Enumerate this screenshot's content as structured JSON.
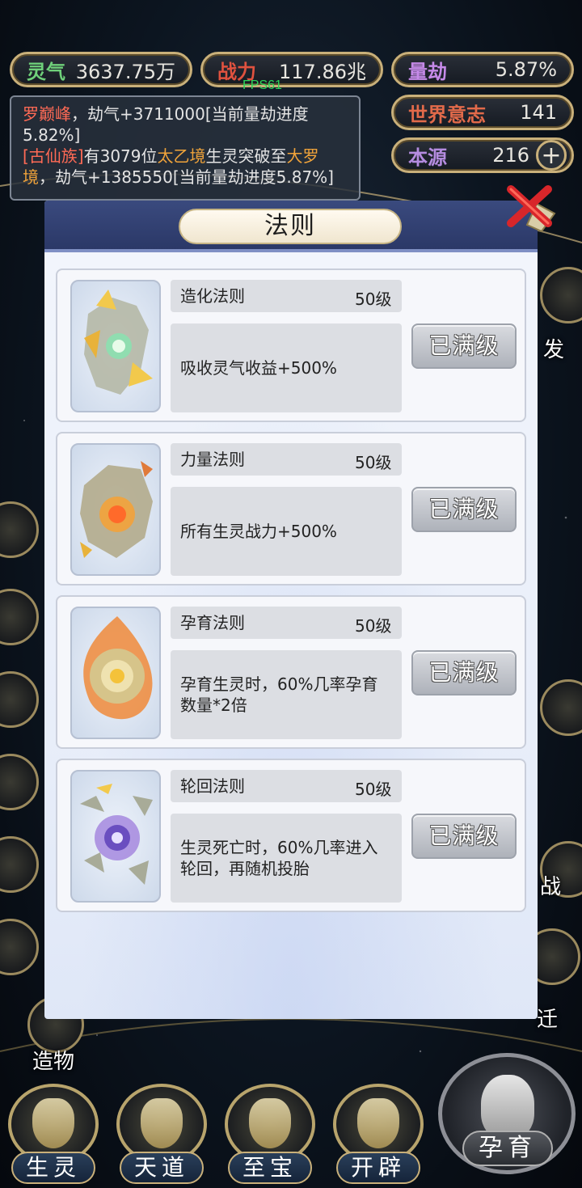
{
  "stats": {
    "lingqi": {
      "key": "灵气",
      "value": "3637.75万"
    },
    "zhanli": {
      "key": "战力",
      "value": "117.86兆"
    },
    "liangjie": {
      "key": "量劫",
      "value": "5.87%"
    },
    "shijie": {
      "key": "世界意志",
      "value": "141"
    },
    "benyuan": {
      "key": "本源",
      "value": "216"
    }
  },
  "fps": "FPS61",
  "log": {
    "line1_name": "罗巅峰",
    "line1_rest": "，劫气+3711000[当前量劫进度5.82%]",
    "line2_a": "[古仙族]",
    "line2_b": "有3079位",
    "line2_c": "太乙境",
    "line2_d": "生灵突破至",
    "line2_e": "大罗境",
    "line2_f": "，劫气+1385550[当前量劫进度5.87%]"
  },
  "side_labels": {
    "left_zaowu": "造物",
    "right_fa": "发",
    "right_zhan": "战",
    "right_qian": "迁"
  },
  "bottom_nav": [
    "生灵",
    "天道",
    "至宝",
    "开辟"
  ],
  "big_button": "孕育",
  "modal": {
    "title": "法则",
    "cards": [
      {
        "name": "造化法则",
        "level": "50级",
        "desc": "吸收灵气收益+500%",
        "button": "已满级"
      },
      {
        "name": "力量法则",
        "level": "50级",
        "desc": "所有生灵战力+500%",
        "button": "已满级"
      },
      {
        "name": "孕育法则",
        "level": "50级",
        "desc": "孕育生灵时，60%几率孕育数量*2倍",
        "button": "已满级"
      },
      {
        "name": "轮回法则",
        "level": "50级",
        "desc": "生灵死亡时，60%几率进入轮回，再随机投胎",
        "button": "已满级"
      }
    ]
  }
}
